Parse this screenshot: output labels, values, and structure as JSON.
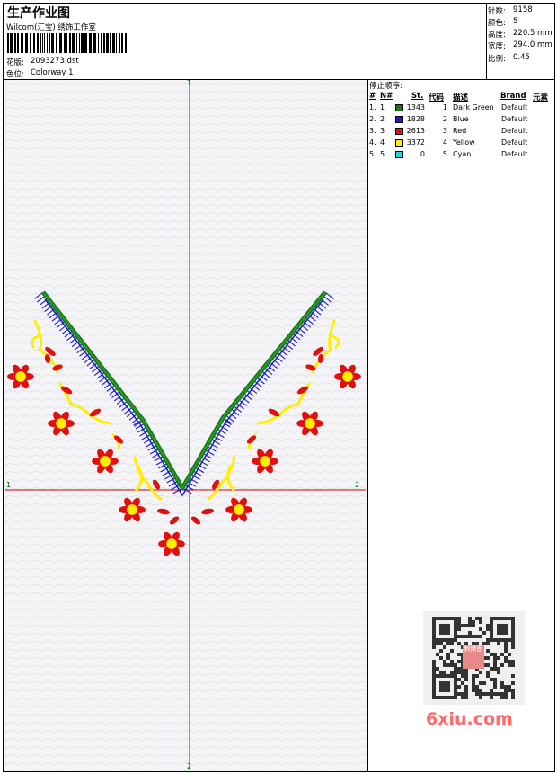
{
  "header": {
    "title": "生产作业图",
    "company": "Wilcom(汇宝) 绣饰工作室",
    "design_label": "花版:",
    "design_value": "2093273.dst",
    "colorway_label": "色位:",
    "colorway_value": "Colorway 1"
  },
  "stats": {
    "stitches_label": "针数:",
    "stitches_value": "9158",
    "colors_label": "颜色:",
    "colors_value": "5",
    "height_label": "高度:",
    "height_value": "220.5 mm",
    "width_label": "宽度:",
    "width_value": "294.0 mm",
    "scale_label": "比例:",
    "scale_value": "0.45"
  },
  "stop_sequence": {
    "title": "停止顺序:",
    "headers": [
      "#",
      "N#",
      "St.",
      "代码",
      "描述",
      "Brand",
      "元素"
    ],
    "rows": [
      {
        "index": "1.",
        "n": "1",
        "color": "#1a7a1a",
        "st": "1343",
        "code": "1",
        "desc": "Dark Green",
        "brand": "Default"
      },
      {
        "index": "2.",
        "n": "2",
        "color": "#1a1acc",
        "st": "1828",
        "code": "2",
        "desc": "Blue",
        "brand": "Default"
      },
      {
        "index": "3.",
        "n": "3",
        "color": "#e01010",
        "st": "2613",
        "code": "3",
        "desc": "Red",
        "brand": "Default"
      },
      {
        "index": "4.",
        "n": "4",
        "color": "#ffee00",
        "st": "3372",
        "code": "4",
        "desc": "Yellow",
        "brand": "Default"
      },
      {
        "index": "5.",
        "n": "5",
        "color": "#22d8e0",
        "st": "0",
        "code": "5",
        "desc": "Cyan",
        "brand": "Default"
      }
    ]
  },
  "axes": {
    "top_label": "1",
    "bottom_label": "2",
    "left_label": "1",
    "right_label": "2"
  },
  "watermark": {
    "text": "6xiu.com",
    "seal_text": "刺绣图"
  },
  "colors": {
    "green": "#1a7a1a",
    "blue": "#1a1acc",
    "red": "#e01010",
    "yellow": "#ffee00",
    "cyan": "#22d8e0",
    "axis": "#cc0000"
  }
}
